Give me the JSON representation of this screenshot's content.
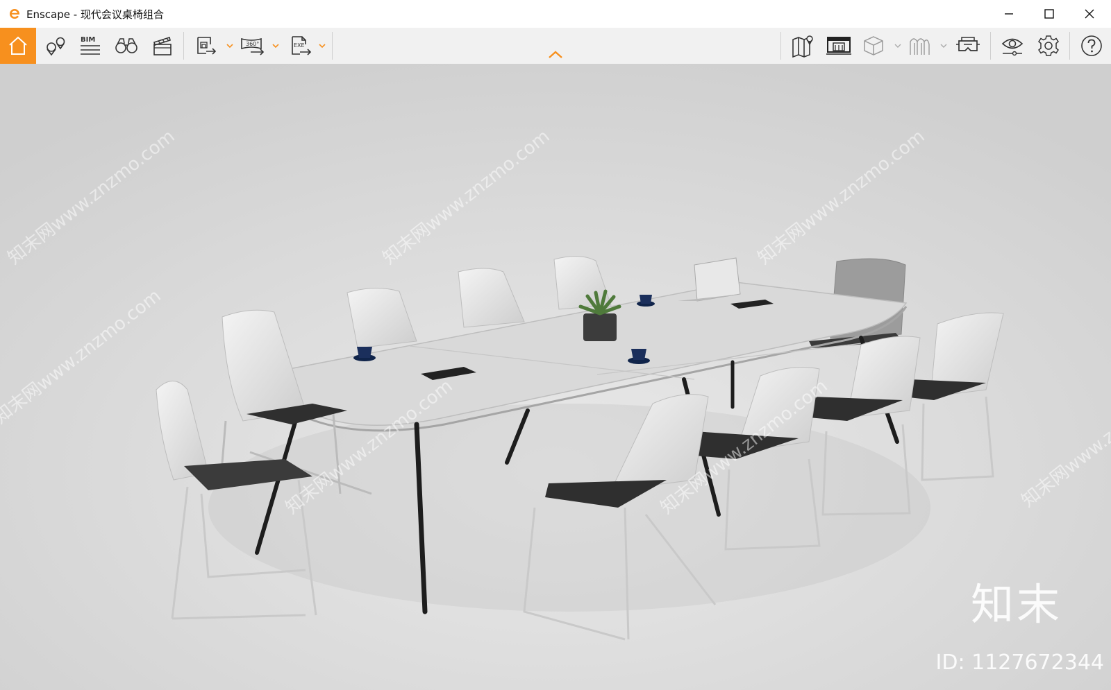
{
  "window": {
    "title": "Enscape - 现代会议桌椅组合",
    "controls": {
      "minimize_icon": "minimize-icon",
      "maximize_icon": "maximize-icon",
      "close_icon": "close-icon"
    }
  },
  "toolbar": {
    "left": [
      {
        "name": "home-button",
        "icon": "home-icon",
        "active": true
      },
      {
        "name": "views-button",
        "icon": "location-pins-icon"
      },
      {
        "name": "bim-button",
        "icon": "bim-icon",
        "label": "BIM"
      },
      {
        "name": "binoculars-button",
        "icon": "binoculars-icon"
      },
      {
        "name": "video-editor-button",
        "icon": "clapperboard-icon"
      },
      {
        "name": "export-image-button",
        "icon": "export-image-icon"
      },
      {
        "name": "export-360-button",
        "icon": "export-360-icon",
        "label": "360°"
      },
      {
        "name": "export-exe-button",
        "icon": "export-exe-icon",
        "label": "EXE"
      }
    ],
    "right": [
      {
        "name": "map-button",
        "icon": "map-icon"
      },
      {
        "name": "web-standalone-button",
        "icon": "monitor-building-icon"
      },
      {
        "name": "asset-library-button",
        "icon": "cube-icon"
      },
      {
        "name": "material-editor-button",
        "icon": "arches-icon"
      },
      {
        "name": "vr-headset-button",
        "icon": "vr-headset-icon"
      },
      {
        "name": "visual-settings-button",
        "icon": "eye-settings-icon"
      },
      {
        "name": "settings-button",
        "icon": "gear-icon"
      },
      {
        "name": "help-button",
        "icon": "help-icon"
      }
    ],
    "collapse_icon": "chevron-up-icon",
    "accent_color": "#f7901e"
  },
  "viewport": {
    "scene": "conference-table-with-chairs",
    "watermark_text": "知末网www.znzmo.com",
    "watermark_brand": "知末",
    "watermark_id": "ID: 1127672344"
  }
}
